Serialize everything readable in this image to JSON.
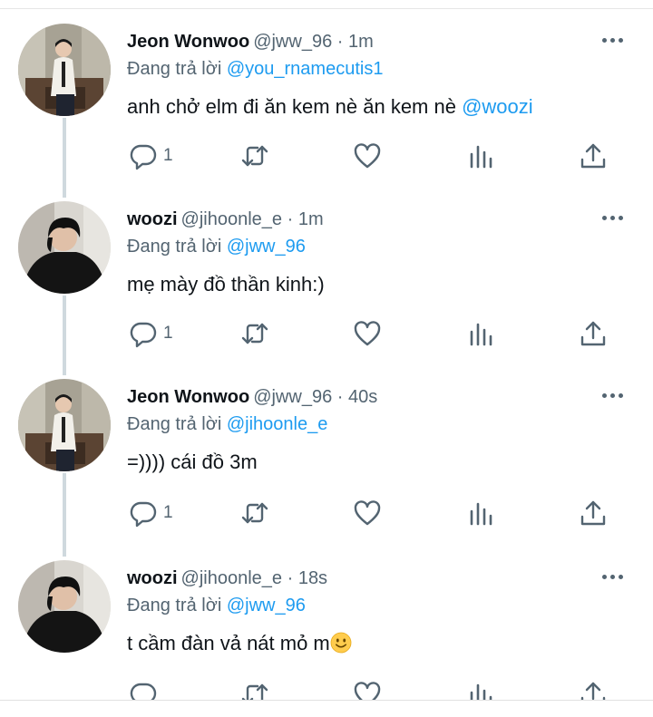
{
  "colors": {
    "accent": "#1d9bf0",
    "secondary_text": "#536471",
    "primary_text": "#0f1419",
    "thread_line": "#cfd9de"
  },
  "replying_label": "Đang trả lời",
  "tweets": [
    {
      "display_name": "Jeon Wonwoo",
      "meta": "@jww_96 · 1m",
      "replying_to": "@you_rnamecutis1",
      "text": "anh chở elm đi ăn kem nè ăn kem nè ",
      "text_mention": "@woozi",
      "reply_count": "1",
      "avatar": "jeon-wonwoo-avatar"
    },
    {
      "display_name": "woozi",
      "meta": "@jihoonle_e · 1m",
      "replying_to": "@jww_96",
      "text": "mẹ mày đồ thần kinh:)",
      "text_mention": "",
      "reply_count": "1",
      "avatar": "woozi-avatar"
    },
    {
      "display_name": "Jeon Wonwoo",
      "meta": "@jww_96 · 40s",
      "replying_to": "@jihoonle_e",
      "text": "=)))) cái đồ 3m",
      "text_mention": "",
      "reply_count": "1",
      "avatar": "jeon-wonwoo-avatar"
    },
    {
      "display_name": "woozi",
      "meta": "@jihoonle_e · 18s",
      "replying_to": "@jww_96",
      "text": "t cầm đàn vả nát mỏ m",
      "text_mention": "",
      "text_emoji": "slightly-smiling-face-emoji",
      "reply_count": "",
      "avatar": "woozi-avatar"
    }
  ],
  "icons": {
    "reply": "reply-icon",
    "retweet": "retweet-icon",
    "like": "heart-icon",
    "analytics": "analytics-icon",
    "share": "share-icon",
    "more": "more-options-icon"
  }
}
